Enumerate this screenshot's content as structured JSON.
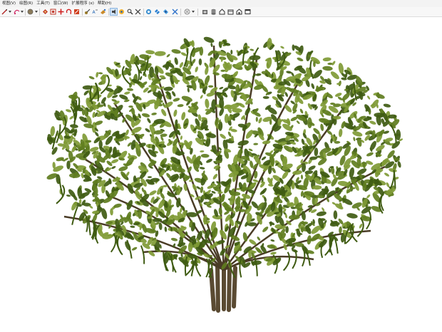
{
  "menu": {
    "items": [
      "视图(V)",
      "绘图(R)",
      "工具(T)",
      "窗口(W)",
      "扩展程序 (x)",
      "帮助(H)"
    ]
  },
  "toolbar": {
    "tools": [
      {
        "icon": "select-arrow-icon",
        "dropdown": true
      },
      {
        "icon": "eraser-icon",
        "dropdown": true
      },
      {
        "icon": "paint-bucket-icon",
        "dropdown": true
      },
      {
        "icon": "push-pull-icon"
      },
      {
        "icon": "offset-icon"
      },
      {
        "icon": "move-icon"
      },
      {
        "icon": "rotate-icon"
      },
      {
        "icon": "scale-icon"
      },
      {
        "icon": "tape-measure-icon"
      },
      {
        "icon": "dimension-icon"
      },
      {
        "icon": "paint-icon"
      },
      {
        "icon": "walk-icon",
        "active": true
      },
      {
        "icon": "look-around-icon"
      },
      {
        "icon": "zoom-icon"
      },
      {
        "icon": "zoom-extents-icon"
      },
      {
        "icon": "section-plane-icon"
      },
      {
        "icon": "section-display-icon"
      },
      {
        "icon": "section-fill-icon"
      },
      {
        "icon": "xray-icon",
        "dropdown": true
      },
      {
        "icon": "warehouse-icon"
      },
      {
        "icon": "components-icon"
      },
      {
        "icon": "home-icon"
      },
      {
        "icon": "scenes-icon"
      },
      {
        "icon": "shapes-icon"
      },
      {
        "icon": "window-icon"
      }
    ]
  },
  "viewport": {
    "subject": "3d-tree-model-icon",
    "colors": {
      "leaf_dark": "#3f5b12",
      "leaf_mid": "#5f7d1f",
      "leaf_light": "#7f9a35",
      "trunk": "#5a4a32"
    }
  }
}
